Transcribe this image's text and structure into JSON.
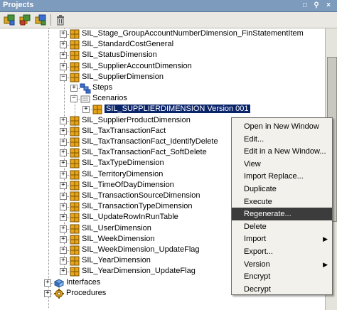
{
  "panel": {
    "title": "Projects",
    "buttons": [
      "minimize-icon",
      "pin-icon",
      "close-icon"
    ],
    "button_glyphs": [
      "□",
      "⚲",
      "×"
    ]
  },
  "toolbar": {
    "icons": [
      "insert-folder-icon",
      "insert-project-icon",
      "insert-package-icon",
      "delete-icon"
    ]
  },
  "tree": {
    "items": [
      {
        "label": "SIL_Stage_GroupAccountNumberDimension_FinStatementItem",
        "level": 0,
        "expander": "+",
        "icon": "interface-icon"
      },
      {
        "label": "SIL_StandardCostGeneral",
        "level": 0,
        "expander": "+",
        "icon": "interface-icon"
      },
      {
        "label": "SIL_StatusDimension",
        "level": 0,
        "expander": "+",
        "icon": "interface-icon"
      },
      {
        "label": "SIL_SupplierAccountDimension",
        "level": 0,
        "expander": "+",
        "icon": "interface-icon"
      },
      {
        "label": "SIL_SupplierDimension",
        "level": 0,
        "expander": "−",
        "icon": "interface-icon"
      },
      {
        "label": "Steps",
        "level": 1,
        "expander": "+",
        "icon": "steps-icon"
      },
      {
        "label": "Scenarios",
        "level": 1,
        "expander": "−",
        "icon": "scenarios-icon"
      },
      {
        "label": "SIL_SUPPLIERDIMENSION Version 001",
        "level": 2,
        "expander": "+",
        "icon": "scenario-icon",
        "selected": true
      },
      {
        "label": "SIL_SupplierProductDimension",
        "level": 0,
        "expander": "+",
        "icon": "interface-icon"
      },
      {
        "label": "SIL_TaxTransactionFact",
        "level": 0,
        "expander": "+",
        "icon": "interface-icon"
      },
      {
        "label": "SIL_TaxTransactionFact_IdentifyDelete",
        "level": 0,
        "expander": "+",
        "icon": "interface-icon"
      },
      {
        "label": "SIL_TaxTransactionFact_SoftDelete",
        "level": 0,
        "expander": "+",
        "icon": "interface-icon"
      },
      {
        "label": "SIL_TaxTypeDimension",
        "level": 0,
        "expander": "+",
        "icon": "interface-icon"
      },
      {
        "label": "SIL_TerritoryDimension",
        "level": 0,
        "expander": "+",
        "icon": "interface-icon"
      },
      {
        "label": "SIL_TimeOfDayDimension",
        "level": 0,
        "expander": "+",
        "icon": "interface-icon"
      },
      {
        "label": "SIL_TransactionSourceDimension",
        "level": 0,
        "expander": "+",
        "icon": "interface-icon"
      },
      {
        "label": "SIL_TransactionTypeDimension",
        "level": 0,
        "expander": "+",
        "icon": "interface-icon"
      },
      {
        "label": "SIL_UpdateRowInRunTable",
        "level": 0,
        "expander": "+",
        "icon": "interface-icon"
      },
      {
        "label": "SIL_UserDimension",
        "level": 0,
        "expander": "+",
        "icon": "interface-icon"
      },
      {
        "label": "SIL_WeekDimension",
        "level": 0,
        "expander": "+",
        "icon": "interface-icon"
      },
      {
        "label": "SIL_WeekDimension_UpdateFlag",
        "level": 0,
        "expander": "+",
        "icon": "interface-icon"
      },
      {
        "label": "SIL_YearDimension",
        "level": 0,
        "expander": "+",
        "icon": "interface-icon"
      },
      {
        "label": "SIL_YearDimension_UpdateFlag",
        "level": 0,
        "expander": "+",
        "icon": "interface-icon"
      },
      {
        "label": "Interfaces",
        "level": -1,
        "expander": "+",
        "icon": "interfaces-folder-icon"
      },
      {
        "label": "Procedures",
        "level": -1,
        "expander": "+",
        "icon": "procedures-icon"
      }
    ]
  },
  "context_menu": {
    "items": [
      {
        "label": "Open in New Window",
        "submenu": false
      },
      {
        "label": "Edit...",
        "submenu": false
      },
      {
        "label": "Edit in a New Window...",
        "submenu": false
      },
      {
        "label": "View",
        "submenu": false
      },
      {
        "label": "Import Replace...",
        "submenu": false
      },
      {
        "label": "Duplicate",
        "submenu": false
      },
      {
        "label": "Execute",
        "submenu": false
      },
      {
        "label": "Regenerate...",
        "submenu": false,
        "highlighted": true
      },
      {
        "label": "Delete",
        "submenu": false
      },
      {
        "label": "Import",
        "submenu": true
      },
      {
        "label": "Export...",
        "submenu": false
      },
      {
        "label": "Version",
        "submenu": true
      },
      {
        "label": "Encrypt",
        "submenu": false
      },
      {
        "label": "Decrypt",
        "submenu": false
      }
    ]
  },
  "colors": {
    "selection": "#0a246a",
    "menu_highlight": "#3c3c3c",
    "interface_icon": "#e8a317"
  }
}
